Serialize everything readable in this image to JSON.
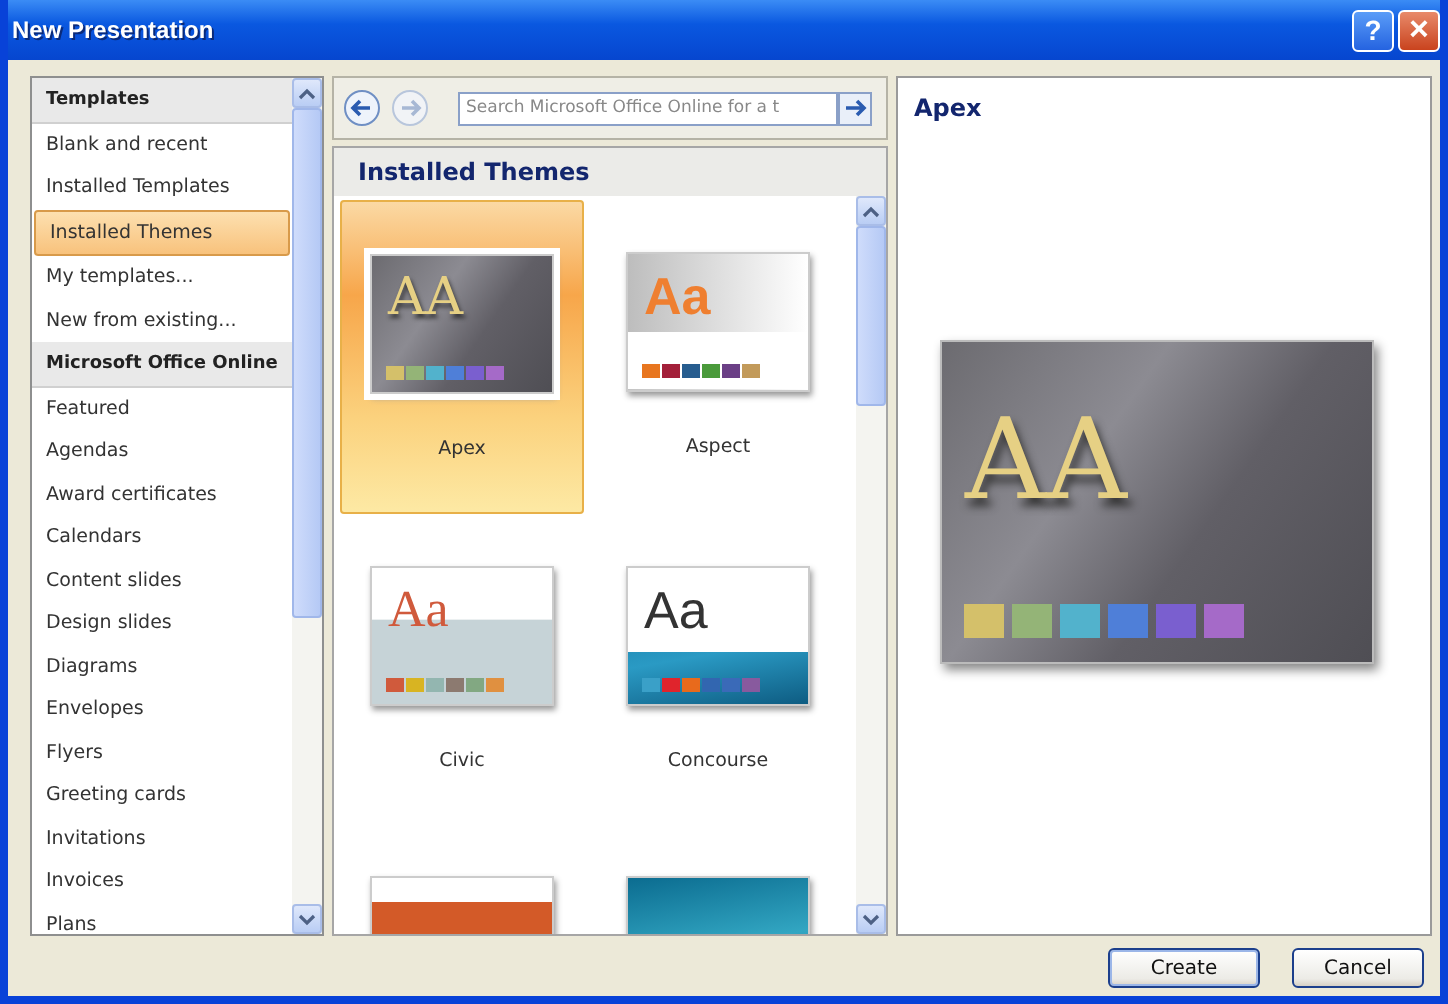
{
  "window": {
    "title": "New Presentation",
    "buttons": [
      "?",
      "×"
    ]
  },
  "sidebar": {
    "items": [
      {
        "label": "Templates",
        "kind": "header",
        "selected": false
      },
      {
        "label": "Blank and recent",
        "kind": "item",
        "selected": false
      },
      {
        "label": "Installed Templates",
        "kind": "item",
        "selected": false
      },
      {
        "label": "Installed Themes",
        "kind": "item",
        "selected": true
      },
      {
        "label": "My templates...",
        "kind": "item",
        "selected": false
      },
      {
        "label": "New from existing...",
        "kind": "item",
        "selected": false
      },
      {
        "label": "Microsoft Office Online",
        "kind": "header",
        "selected": false
      },
      {
        "label": "Featured",
        "kind": "item",
        "selected": false
      },
      {
        "label": "Agendas",
        "kind": "item",
        "selected": false
      },
      {
        "label": "Award certificates",
        "kind": "item",
        "selected": false
      },
      {
        "label": "Calendars",
        "kind": "item",
        "selected": false
      },
      {
        "label": "Content slides",
        "kind": "item",
        "selected": false
      },
      {
        "label": "Design slides",
        "kind": "item",
        "selected": false
      },
      {
        "label": "Diagrams",
        "kind": "item",
        "selected": false
      },
      {
        "label": "Envelopes",
        "kind": "item",
        "selected": false
      },
      {
        "label": "Flyers",
        "kind": "item",
        "selected": false
      },
      {
        "label": "Greeting cards",
        "kind": "item",
        "selected": false
      },
      {
        "label": "Invitations",
        "kind": "item",
        "selected": false
      },
      {
        "label": "Invoices",
        "kind": "item",
        "selected": false
      },
      {
        "label": "Plans",
        "kind": "item",
        "selected": false
      }
    ]
  },
  "search": {
    "placeholder": "Search Microsoft Office Online for a t"
  },
  "gallery": {
    "title": "Installed Themes",
    "themes": [
      {
        "name": "Apex",
        "kind": "dark",
        "sample": "AA",
        "selected": true,
        "swatches": [
          {
            "color": "#d4c06a"
          },
          {
            "color": "#94b477"
          },
          {
            "color": "#52b2cc"
          },
          {
            "color": "#4f7fd8"
          },
          {
            "color": "#7a5fcf"
          },
          {
            "color": "#a56ac8"
          }
        ]
      },
      {
        "name": "Aspect",
        "kind": "fade",
        "sample": "Aa",
        "selected": false,
        "swatches": [
          {
            "color": "#e8761f"
          },
          {
            "color": "#a3203a"
          },
          {
            "color": "#275d8f"
          },
          {
            "color": "#4a9a3b"
          },
          {
            "color": "#6b3f86"
          },
          {
            "color": "#c29a5a"
          }
        ]
      },
      {
        "name": "Civic",
        "kind": "band",
        "sample": "Aa",
        "selected": false,
        "swatches": [
          {
            "color": "#d05a3c"
          },
          {
            "color": "#d8b422"
          },
          {
            "color": "#93b6b0"
          },
          {
            "color": "#8c7a70"
          },
          {
            "color": "#82a882"
          },
          {
            "color": "#e09040"
          }
        ]
      },
      {
        "name": "Concourse",
        "kind": "wave",
        "sample": "Aa",
        "selected": false,
        "swatches": [
          {
            "color": "#3aa0c8"
          },
          {
            "color": "#e0242c"
          },
          {
            "color": "#e86a1c"
          },
          {
            "color": "#3266b0"
          },
          {
            "color": "#3a6ab8"
          },
          {
            "color": "#885a9e"
          }
        ]
      },
      {
        "kind": "orange",
        "selected": false
      },
      {
        "kind": "teal",
        "selected": false
      }
    ]
  },
  "preview": {
    "title": "Apex",
    "sample": "AA",
    "swatches": [
      {
        "color": "#d4c06a"
      },
      {
        "color": "#94b477"
      },
      {
        "color": "#52b2cc"
      },
      {
        "color": "#4f7fd8"
      },
      {
        "color": "#7a5fcf"
      },
      {
        "color": "#a56ac8"
      }
    ]
  },
  "buttons": [
    "Create",
    "Cancel"
  ]
}
